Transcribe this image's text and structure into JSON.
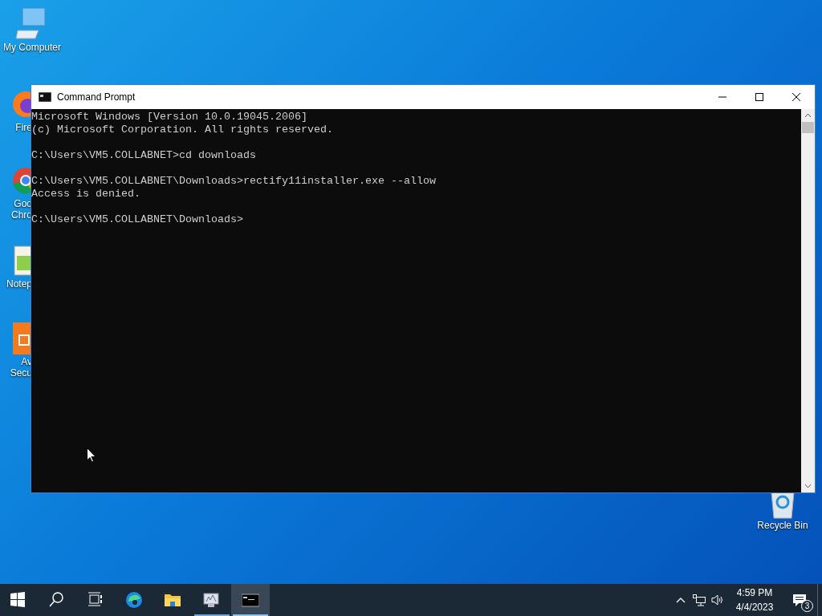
{
  "desktop_icons": [
    {
      "kind": "computer",
      "label_lines": [
        "My Computer"
      ]
    },
    {
      "kind": "firefox",
      "label_lines": [
        "Fire"
      ]
    },
    {
      "kind": "chrome",
      "label_lines": [
        "Goo",
        "Chro"
      ]
    },
    {
      "kind": "notepad",
      "label_lines": [
        "Notep"
      ]
    },
    {
      "kind": "avast",
      "label_lines": [
        "Av",
        "Secu"
      ]
    },
    {
      "kind": "recycle",
      "label_lines": [
        "Recycle Bin"
      ]
    }
  ],
  "window": {
    "title": "Command Prompt",
    "output_blocks": [
      [
        "Microsoft Windows [Version 10.0.19045.2006]",
        "(c) Microsoft Corporation. All rights reserved."
      ],
      [
        "C:\\Users\\VM5.COLLABNET>cd downloads"
      ],
      [
        "C:\\Users\\VM5.COLLABNET\\Downloads>rectify11installer.exe --allow",
        "Access is denied."
      ],
      [
        "C:\\Users\\VM5.COLLABNET\\Downloads>"
      ]
    ]
  },
  "taskbar": {
    "items": [
      {
        "kind": "start",
        "running": false,
        "selected": false
      },
      {
        "kind": "search",
        "running": false,
        "selected": false
      },
      {
        "kind": "taskview",
        "running": false,
        "selected": false
      },
      {
        "kind": "edge",
        "running": false,
        "selected": false
      },
      {
        "kind": "explorer",
        "running": false,
        "selected": false
      },
      {
        "kind": "monitor",
        "running": true,
        "selected": false
      },
      {
        "kind": "cmd",
        "running": true,
        "selected": true
      }
    ],
    "clock": {
      "time": "4:59 PM",
      "date": "4/4/2023"
    },
    "notification_count": "3"
  }
}
